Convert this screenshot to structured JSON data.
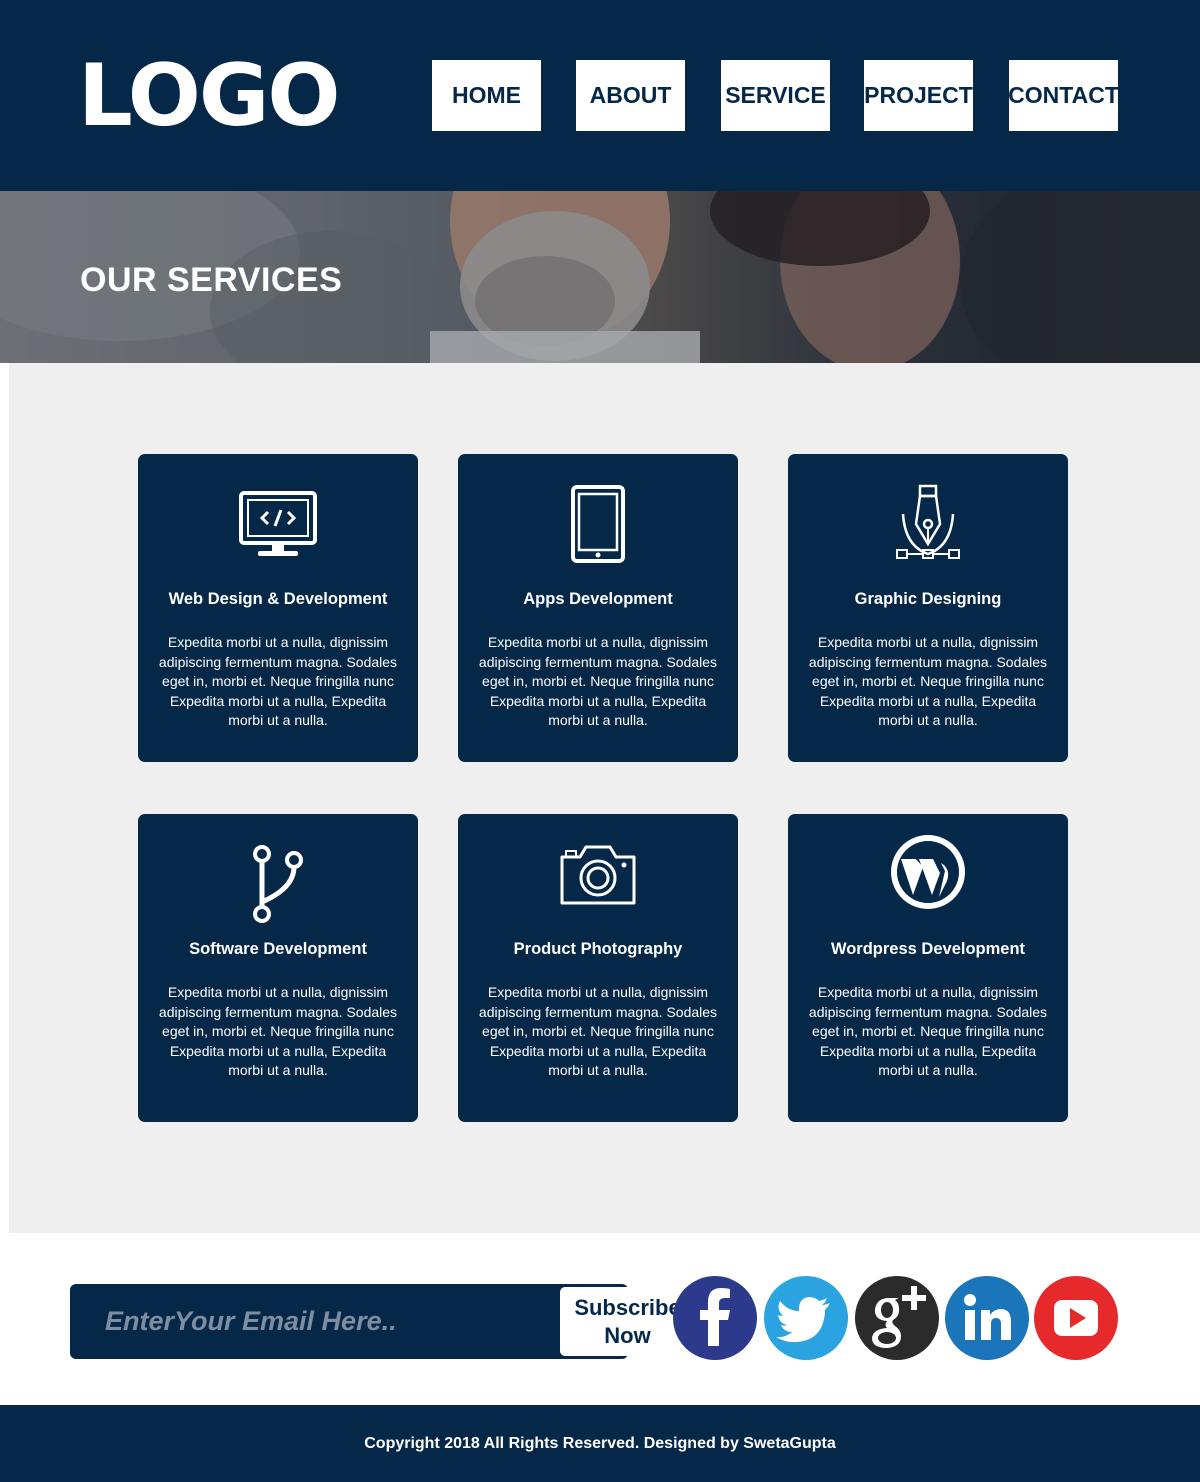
{
  "header": {
    "logo": "LOGO",
    "nav": [
      "HOME",
      "ABOUT",
      "SERVICE",
      "PROJECT",
      "CONTACT"
    ]
  },
  "banner": {
    "title": "OUR SERVICES"
  },
  "services": [
    {
      "title": "Web Design & Development",
      "icon": "monitor-code-icon",
      "desc": "Expedita morbi ut a nulla, dignissim adipiscing fermentum magna. Sodales eget in, morbi et. Neque fringilla nunc Expedita morbi ut a nulla, Expedita morbi ut a nulla."
    },
    {
      "title": "Apps Development",
      "icon": "tablet-icon",
      "desc": "Expedita morbi ut a nulla, dignissim adipiscing fermentum magna. Sodales eget in, morbi et. Neque fringilla nunc Expedita morbi ut a nulla, Expedita morbi ut a nulla."
    },
    {
      "title": "Graphic Designing",
      "icon": "pen-tool-icon",
      "desc": "Expedita morbi ut a nulla, dignissim adipiscing fermentum magna. Sodales eget in, morbi et. Neque fringilla nunc Expedita morbi ut a nulla, Expedita morbi ut a nulla."
    },
    {
      "title": "Software Development",
      "icon": "git-branch-icon",
      "desc": "Expedita morbi ut a nulla, dignissim adipiscing fermentum magna. Sodales eget in, morbi et. Neque fringilla nunc Expedita morbi ut a nulla, Expedita morbi ut a nulla."
    },
    {
      "title": "Product Photography",
      "icon": "camera-icon",
      "desc": "Expedita morbi ut a nulla, dignissim adipiscing fermentum magna. Sodales eget in, morbi et. Neque fringilla nunc Expedita morbi ut a nulla, Expedita morbi ut a nulla."
    },
    {
      "title": "Wordpress Development",
      "icon": "wordpress-icon",
      "desc": "Expedita morbi ut a nulla, dignissim adipiscing fermentum magna. Sodales eget in, morbi et. Neque fringilla nunc Expedita morbi ut a nulla, Expedita morbi ut a nulla."
    }
  ],
  "subscribe": {
    "placeholder": "EnterYour Email Here..",
    "button_line1": "Subscribe",
    "button_line2": "Now"
  },
  "social": [
    {
      "icon": "facebook-icon",
      "color": "#2d3a8c"
    },
    {
      "icon": "twitter-icon",
      "color": "#2aa3e0"
    },
    {
      "icon": "google-plus-icon",
      "color": "#2b2b2b"
    },
    {
      "icon": "linkedin-icon",
      "color": "#1a75bb"
    },
    {
      "icon": "youtube-icon",
      "color": "#e62a2c"
    }
  ],
  "colors": {
    "navy": "#062848",
    "panel": "#efefef"
  },
  "footer": {
    "text": "Copyright 2018 All Rights Reserved. Designed by SwetaGupta"
  }
}
